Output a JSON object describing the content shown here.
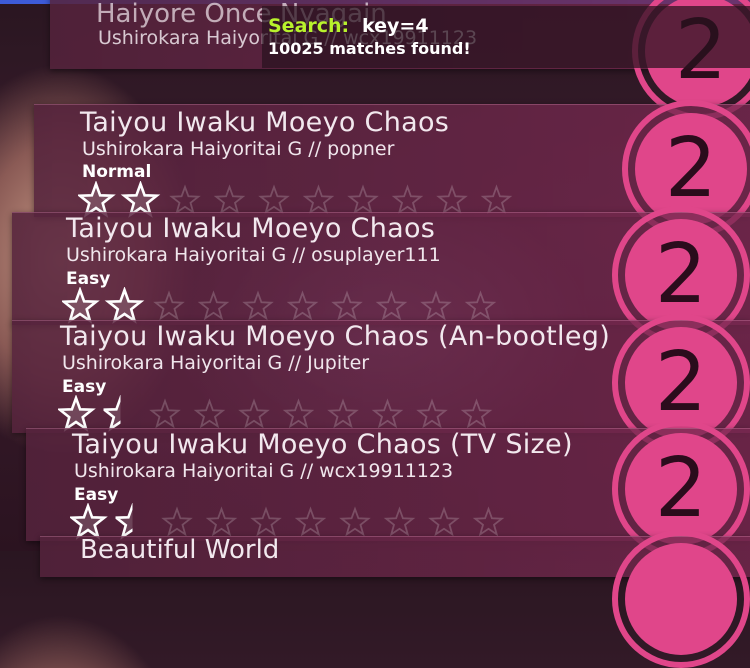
{
  "search": {
    "label": "Search:",
    "query": "key=4",
    "results": "10025 matches found!"
  },
  "top_partial": {
    "title": "Haiyore Once Nyagain",
    "artist": "Ushirokara Haiyoritai G // wcx19911123",
    "badge": "2"
  },
  "songs": [
    {
      "title": "Taiyou Iwaku Moeyo Chaos",
      "artist": "Ushirokara Haiyoritai G // popner",
      "difficulty": "Normal",
      "stars": 2,
      "stars_total": 10,
      "badge": "2"
    },
    {
      "title": "Taiyou Iwaku Moeyo Chaos",
      "artist": "Ushirokara Haiyoritai G // osuplayer111",
      "difficulty": "Easy",
      "stars": 2,
      "stars_total": 10,
      "badge": "2"
    },
    {
      "title": "Taiyou Iwaku Moeyo Chaos (An-bootleg)",
      "artist": "Ushirokara Haiyoritai G // Jupiter",
      "difficulty": "Easy",
      "stars": 1.5,
      "stars_total": 10,
      "badge": "2"
    },
    {
      "title": "Taiyou Iwaku Moeyo Chaos (TV Size)",
      "artist": "Ushirokara Haiyoritai G // wcx19911123",
      "difficulty": "Easy",
      "stars": 1.5,
      "stars_total": 10,
      "badge": "2"
    }
  ],
  "bottom_partial": {
    "title": "Beautiful World"
  },
  "colors": {
    "accent": "#e0468a",
    "search_label": "#b8f22c",
    "top_bar": "#3d5bd8"
  }
}
